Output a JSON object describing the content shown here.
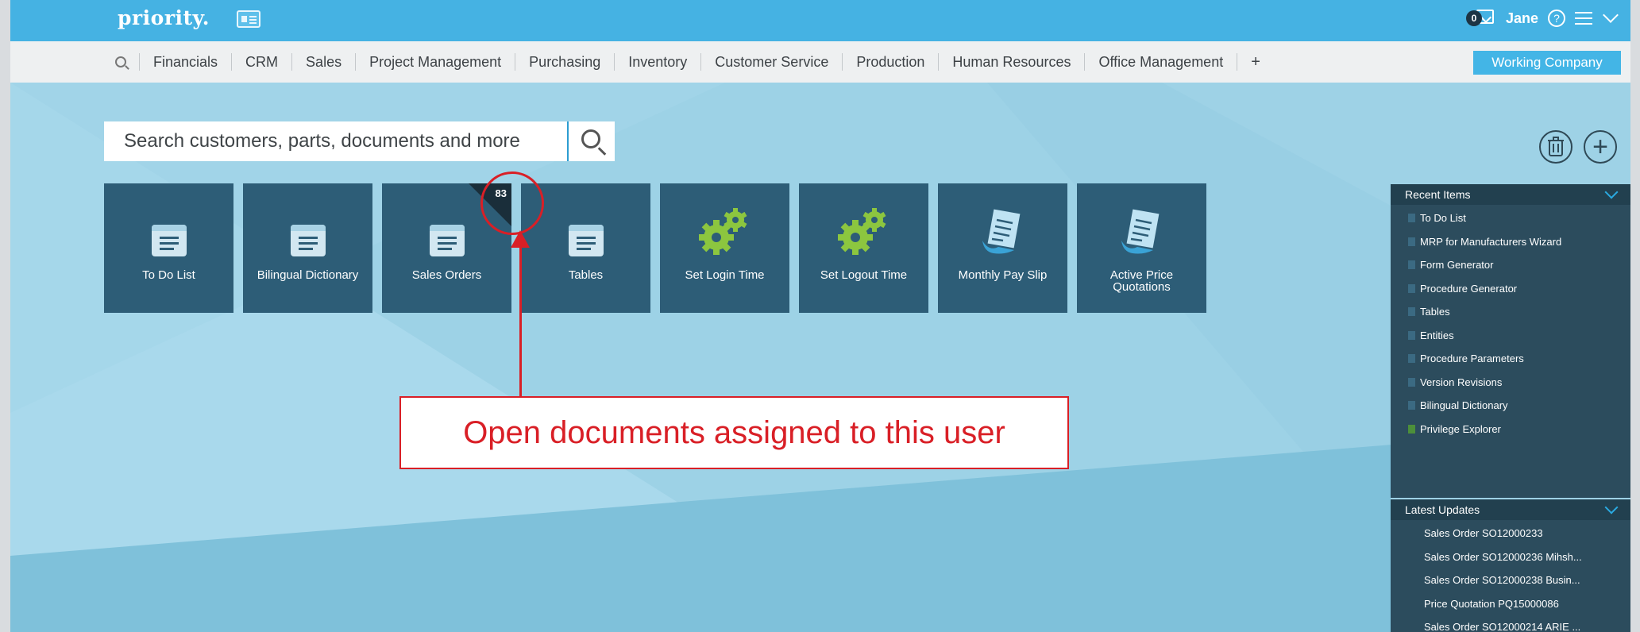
{
  "app": {
    "logo": "priority.",
    "user": {
      "name": "Jane",
      "message_count": "0"
    },
    "company_label": "Working Company"
  },
  "nav": {
    "items": [
      "Financials",
      "CRM",
      "Sales",
      "Project Management",
      "Purchasing",
      "Inventory",
      "Customer Service",
      "Production",
      "Human Resources",
      "Office Management"
    ],
    "plus": "+"
  },
  "search": {
    "placeholder": "Search customers, parts, documents and more"
  },
  "tiles": [
    {
      "label": "To Do List",
      "icon": "list-card-icon"
    },
    {
      "label": "Bilingual Dictionary",
      "icon": "list-card-icon"
    },
    {
      "label": "Sales Orders",
      "icon": "list-card-icon",
      "badge": "83"
    },
    {
      "label": "Tables",
      "icon": "list-card-icon"
    },
    {
      "label": "Set Login Time",
      "icon": "gears-icon"
    },
    {
      "label": "Set Logout Time",
      "icon": "gears-icon"
    },
    {
      "label": "Monthly Pay Slip",
      "icon": "document-icon"
    },
    {
      "label": "Active Price Quotations",
      "icon": "document-icon"
    }
  ],
  "recent": {
    "title": "Recent Items",
    "items": [
      "To Do List",
      "MRP for Manufacturers Wizard",
      "Form Generator",
      "Procedure Generator",
      "Tables",
      "Entities",
      "Procedure Parameters",
      "Version Revisions",
      "Bilingual Dictionary",
      "Privilege Explorer"
    ]
  },
  "updates": {
    "title": "Latest Updates",
    "items": [
      "Sales Order SO12000233",
      "Sales Order SO12000236 Mihsh...",
      "Sales Order SO12000238 Busin...",
      "Price Quotation PQ15000086",
      "Sales Order SO12000214 ARIE ..."
    ]
  },
  "annotation": {
    "text": "Open documents assigned to this user"
  },
  "colors": {
    "topbar": "#45b2e3",
    "tile": "#2d5d77",
    "panel": "#2c4c5d",
    "accent_red": "#d91f26",
    "gear_green": "#8cc63f"
  }
}
